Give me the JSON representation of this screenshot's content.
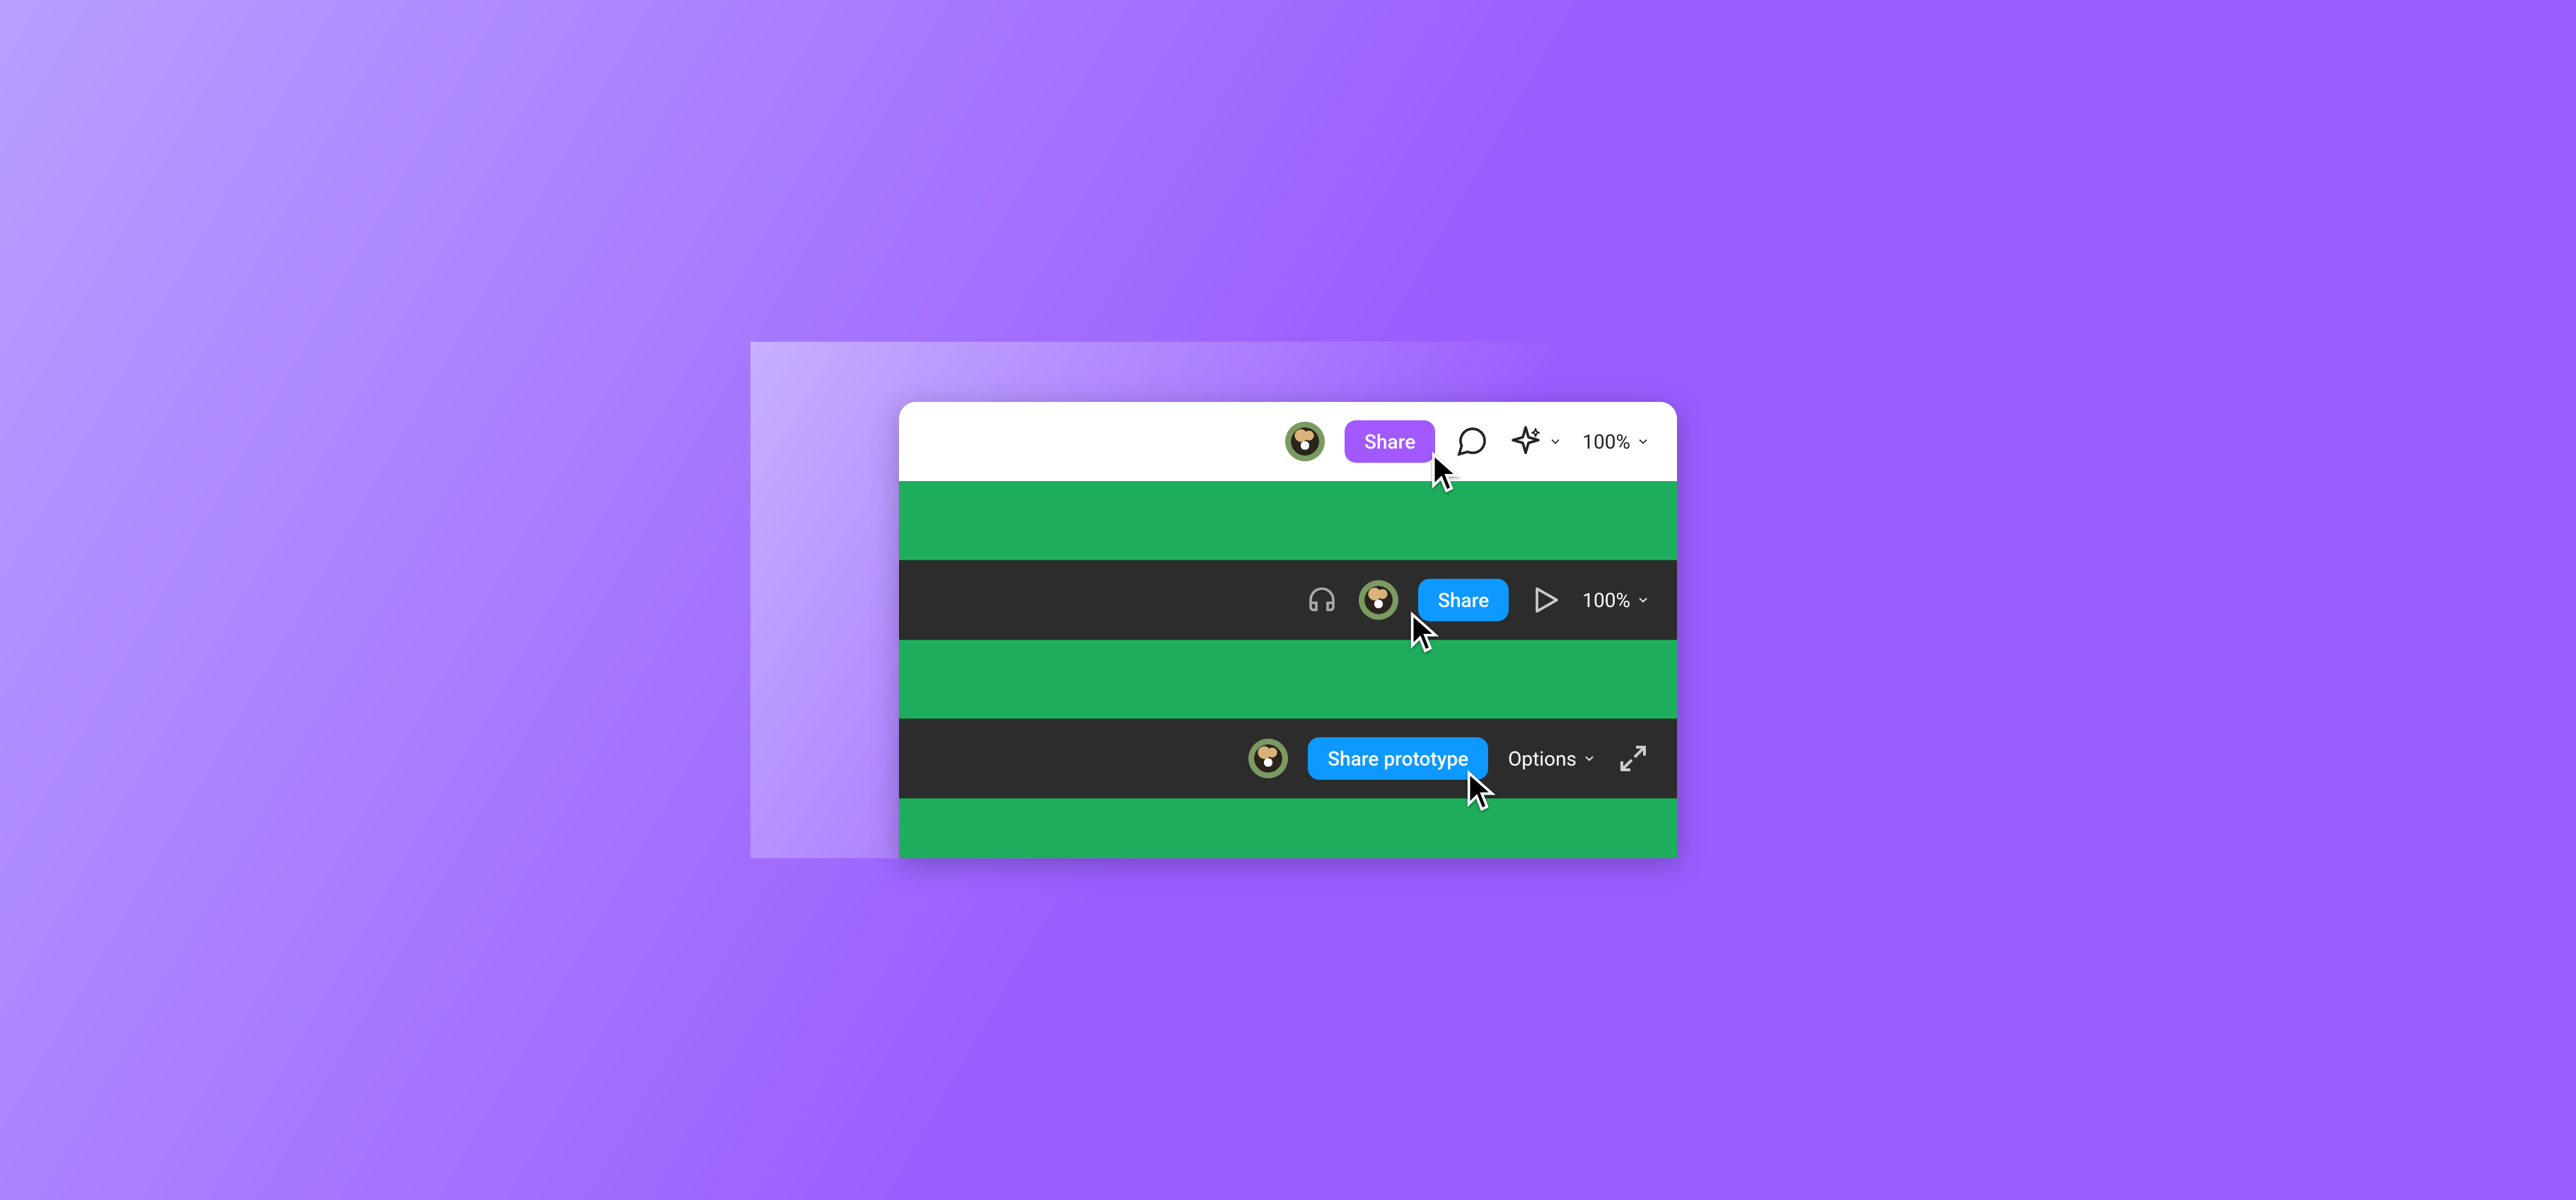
{
  "toolbar_light": {
    "share_label": "Share",
    "zoom_label": "100%"
  },
  "toolbar_dark": {
    "share_label": "Share",
    "zoom_label": "100%"
  },
  "toolbar_prototype": {
    "share_label": "Share prototype",
    "options_label": "Options"
  },
  "colors": {
    "accent_purple": "#a259ff",
    "accent_blue": "#0d99ff",
    "canvas_green": "#1fae5d",
    "bg_gradient_start": "#c6b0ff",
    "bg_gradient_end": "#9a5dff"
  }
}
